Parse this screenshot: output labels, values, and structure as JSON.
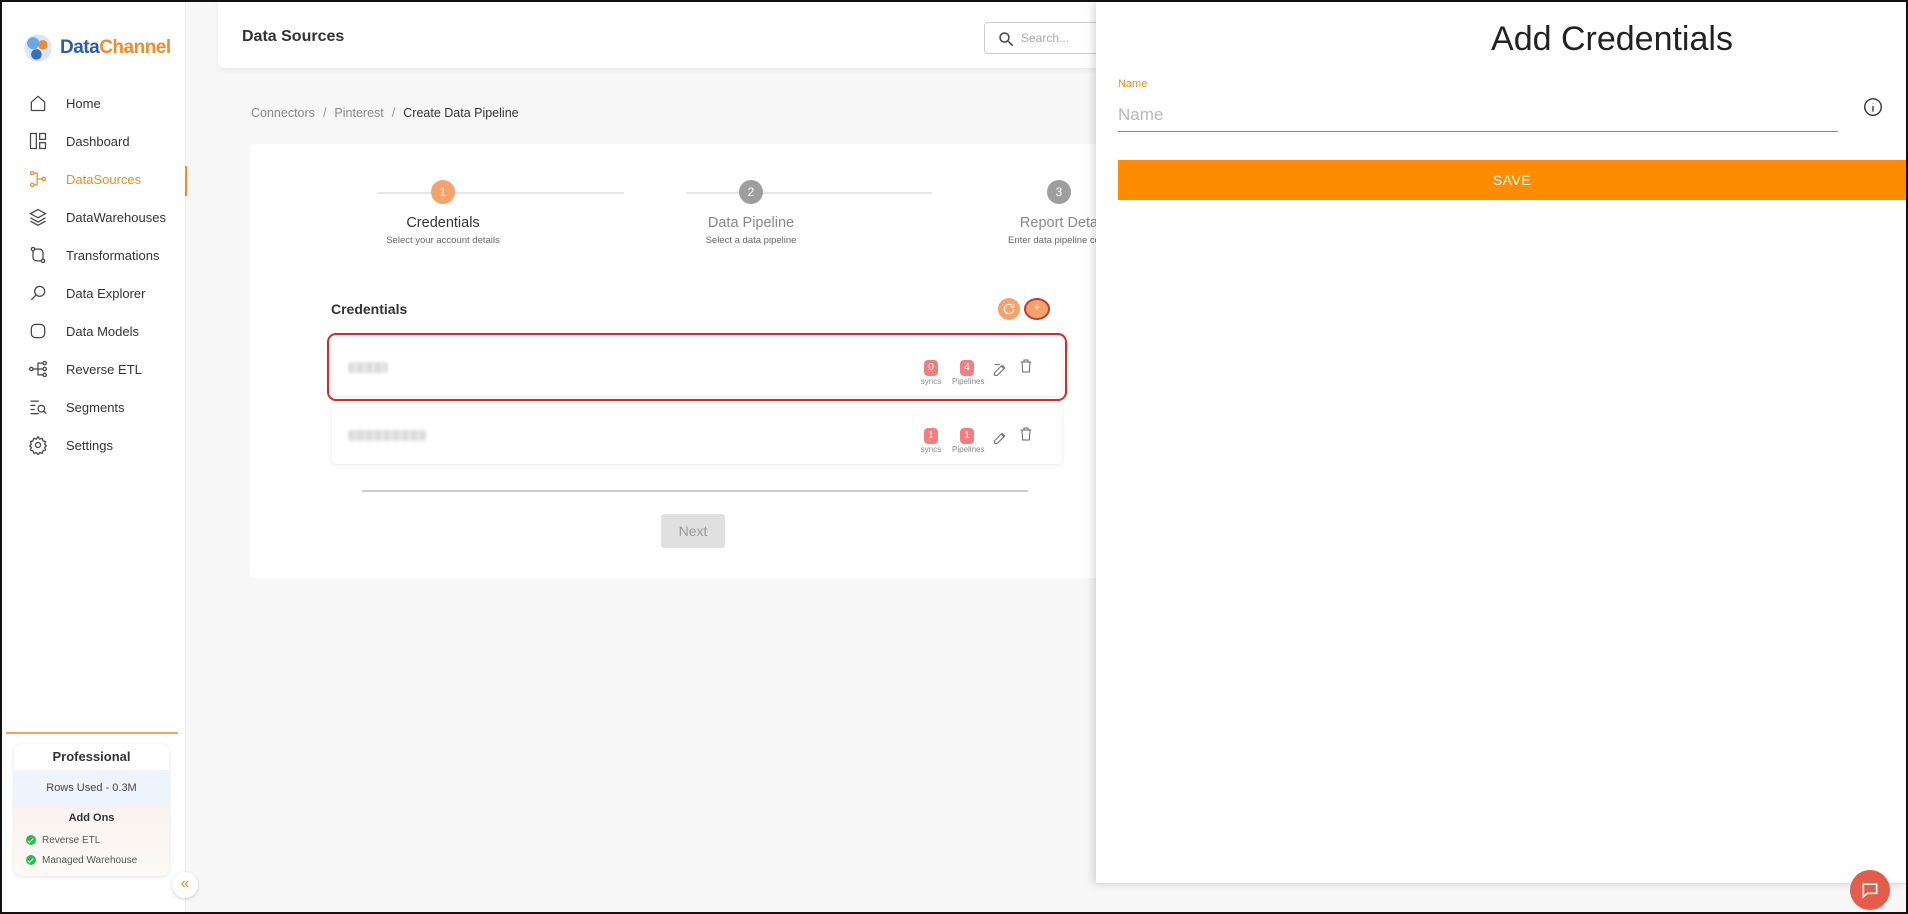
{
  "app": {
    "brand_data": "Data",
    "brand_channel": "Channel"
  },
  "nav": {
    "items": [
      {
        "label": "Home",
        "icon": "home-icon"
      },
      {
        "label": "Dashboard",
        "icon": "dashboard-icon"
      },
      {
        "label": "DataSources",
        "icon": "datasources-icon",
        "active": true
      },
      {
        "label": "DataWarehouses",
        "icon": "layers-icon"
      },
      {
        "label": "Transformations",
        "icon": "transform-icon"
      },
      {
        "label": "Data Explorer",
        "icon": "explorer-icon"
      },
      {
        "label": "Data Models",
        "icon": "models-icon"
      },
      {
        "label": "Reverse ETL",
        "icon": "reverse-etl-icon"
      },
      {
        "label": "Segments",
        "icon": "segments-icon"
      },
      {
        "label": "Settings",
        "icon": "gear-icon"
      }
    ]
  },
  "plan": {
    "name": "Professional",
    "rows_used": "Rows Used - 0.3M",
    "addons_title": "Add Ons",
    "addons": [
      "Reverse ETL",
      "Managed Warehouse"
    ]
  },
  "header": {
    "title": "Data Sources",
    "search_placeholder": "Search..."
  },
  "breadcrumb": {
    "items": [
      "Connectors",
      "Pinterest"
    ],
    "current": "Create Data Pipeline",
    "separator": "/"
  },
  "stepper": {
    "steps": [
      {
        "num": "1",
        "title": "Credentials",
        "sub": "Select your account details"
      },
      {
        "num": "2",
        "title": "Data Pipeline",
        "sub": "Select a data pipeline"
      },
      {
        "num": "3",
        "title": "Report Deta",
        "sub": "Enter data pipeline confi"
      }
    ]
  },
  "credentials": {
    "title": "Credentials",
    "add_label": "+",
    "rows": [
      {
        "syncs": "0",
        "pipelines": "4",
        "syncs_label": "syncs",
        "pipelines_label": "Pipelines"
      },
      {
        "syncs": "1",
        "pipelines": "1",
        "syncs_label": "syncs",
        "pipelines_label": "Pipelines"
      }
    ],
    "next_label": "Next"
  },
  "drawer": {
    "title": "Add Credentials",
    "name_label": "Name",
    "name_placeholder": "Name",
    "save_label": "SAVE"
  },
  "colors": {
    "accent": "#f28c28",
    "save": "#ff8c00",
    "badge": "#f08080",
    "highlight": "#d62a2a"
  }
}
